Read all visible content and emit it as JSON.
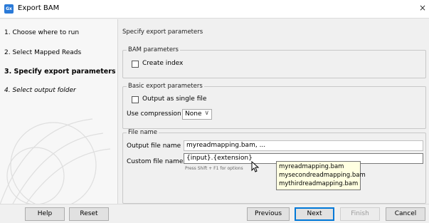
{
  "window": {
    "title": "Export BAM",
    "app_icon_text": "Gx",
    "close_glyph": "×"
  },
  "steps": [
    {
      "label": "1.  Choose where to run"
    },
    {
      "label": "2.  Select Mapped Reads"
    },
    {
      "label": "3.  Specify export parameters"
    },
    {
      "label": "4.  Select output folder"
    }
  ],
  "content": {
    "section_title": "Specify export parameters",
    "bam_group": {
      "legend": "BAM parameters",
      "create_index_label": "Create index",
      "create_index_checked": false
    },
    "basic_group": {
      "legend": "Basic export parameters",
      "single_file_label": "Output as single file",
      "single_file_checked": false,
      "compression_label": "Use compression",
      "compression_value": "None"
    },
    "file_group": {
      "legend": "File name",
      "output_label": "Output file name",
      "output_value": "myreadmapping.bam, ...",
      "custom_label": "Custom file name",
      "custom_value": "{input}.{extension}",
      "hint": "Press Shift + F1 for options"
    }
  },
  "tooltip": {
    "lines": [
      "myreadmapping.bam",
      "mysecondreadmapping.bam",
      "mythirdreadmapping.bam"
    ]
  },
  "buttons": {
    "help": "Help",
    "reset": "Reset",
    "previous": "Previous",
    "next": "Next",
    "finish": "Finish",
    "cancel": "Cancel"
  },
  "colors": {
    "accent": "#0078d7",
    "tooltip_bg": "#ffffe1",
    "app_icon": "#2a7ad8"
  }
}
